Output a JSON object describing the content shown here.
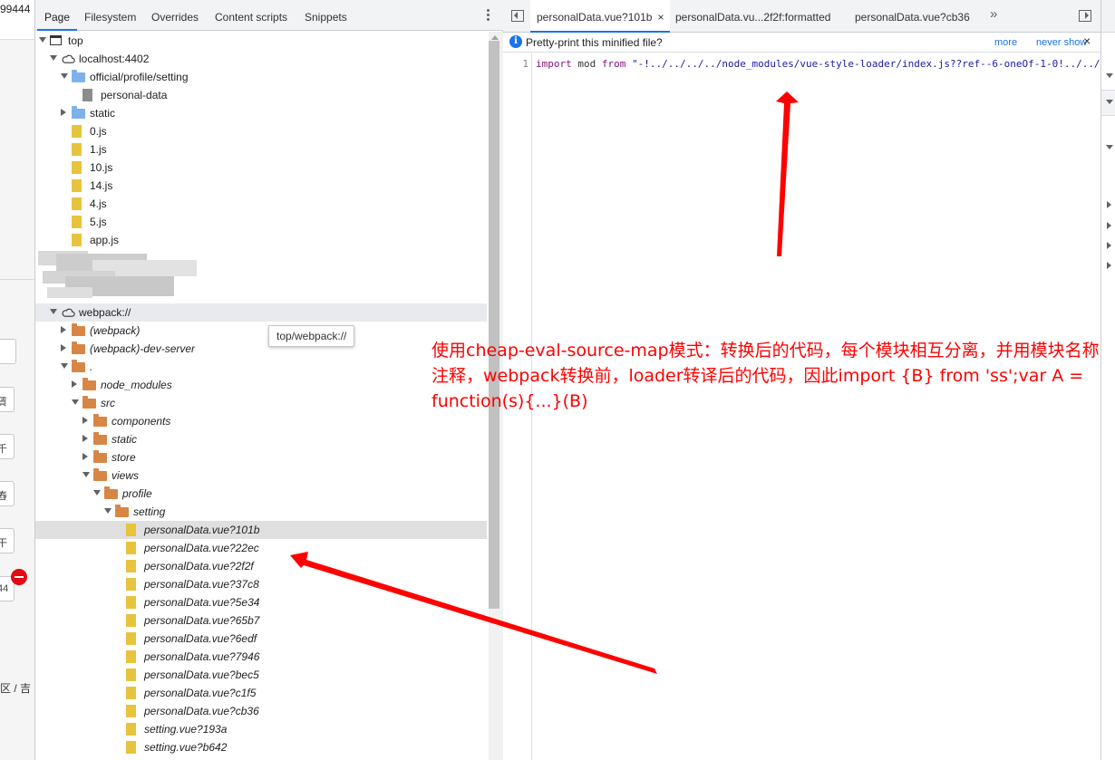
{
  "left_strip": {
    "number": "99444",
    "box_glyphs": [
      "賃",
      "千",
      "舂",
      "干"
    ],
    "stepper_value": "44",
    "district": "区 / 吉"
  },
  "navigator": {
    "tabs": [
      {
        "label": "Page",
        "active": true
      },
      {
        "label": "Filesystem",
        "active": false
      },
      {
        "label": "Overrides",
        "active": false
      },
      {
        "label": "Content scripts",
        "active": false
      },
      {
        "label": "Snippets",
        "active": false
      }
    ],
    "tree": [
      {
        "label": "top",
        "icon": "frame-icon",
        "toggle": "down",
        "level": 0,
        "italic": false
      },
      {
        "label": "localhost:4402",
        "icon": "cloud-icon",
        "toggle": "down",
        "level": 1,
        "italic": false
      },
      {
        "label": "official/profile/setting",
        "icon": "folder-icon",
        "color": "blue",
        "toggle": "down",
        "level": 2,
        "italic": false
      },
      {
        "label": "personal-data",
        "icon": "file-icon",
        "color": "grey",
        "toggle": "none",
        "level": 3,
        "italic": false
      },
      {
        "label": "static",
        "icon": "folder-icon",
        "color": "blue",
        "toggle": "right",
        "level": 2,
        "italic": false
      },
      {
        "label": "0.js",
        "icon": "file-icon",
        "color": "yellow",
        "toggle": "none",
        "level": 2,
        "italic": false
      },
      {
        "label": "1.js",
        "icon": "file-icon",
        "color": "yellow",
        "toggle": "none",
        "level": 2,
        "italic": false
      },
      {
        "label": "10.js",
        "icon": "file-icon",
        "color": "yellow",
        "toggle": "none",
        "level": 2,
        "italic": false
      },
      {
        "label": "14.js",
        "icon": "file-icon",
        "color": "yellow",
        "toggle": "none",
        "level": 2,
        "italic": false
      },
      {
        "label": "4.js",
        "icon": "file-icon",
        "color": "yellow",
        "toggle": "none",
        "level": 2,
        "italic": false
      },
      {
        "label": "5.js",
        "icon": "file-icon",
        "color": "yellow",
        "toggle": "none",
        "level": 2,
        "italic": false
      },
      {
        "label": "app.js",
        "icon": "file-icon",
        "color": "yellow",
        "toggle": "none",
        "level": 2,
        "italic": false
      },
      {
        "label": "",
        "icon": "none",
        "toggle": "blurred",
        "level": 0,
        "italic": false
      },
      {
        "label": "",
        "icon": "none",
        "toggle": "blurred",
        "level": 0,
        "italic": false
      },
      {
        "label": "",
        "icon": "none",
        "toggle": "blurred",
        "level": 0,
        "italic": false
      },
      {
        "label": "webpack://",
        "icon": "cloud-icon",
        "toggle": "down",
        "level": 1,
        "italic": false,
        "highlight": true
      },
      {
        "label": "(webpack)",
        "icon": "folder-icon",
        "color": "orange",
        "toggle": "right",
        "level": 2,
        "italic": true
      },
      {
        "label": "(webpack)-dev-server",
        "icon": "folder-icon",
        "color": "orange",
        "toggle": "right",
        "level": 2,
        "italic": true
      },
      {
        "label": ".",
        "icon": "folder-icon",
        "color": "orange",
        "toggle": "down",
        "level": 2,
        "italic": true
      },
      {
        "label": "node_modules",
        "icon": "folder-icon",
        "color": "orange",
        "toggle": "right",
        "level": 3,
        "italic": true
      },
      {
        "label": "src",
        "icon": "folder-icon",
        "color": "orange",
        "toggle": "down",
        "level": 3,
        "italic": true
      },
      {
        "label": "components",
        "icon": "folder-icon",
        "color": "orange",
        "toggle": "right",
        "level": 4,
        "italic": true
      },
      {
        "label": "static",
        "icon": "folder-icon",
        "color": "orange",
        "toggle": "right",
        "level": 4,
        "italic": true
      },
      {
        "label": "store",
        "icon": "folder-icon",
        "color": "orange",
        "toggle": "right",
        "level": 4,
        "italic": true
      },
      {
        "label": "views",
        "icon": "folder-icon",
        "color": "orange",
        "toggle": "down",
        "level": 4,
        "italic": true
      },
      {
        "label": "profile",
        "icon": "folder-icon",
        "color": "orange",
        "toggle": "down",
        "level": 5,
        "italic": true
      },
      {
        "label": "setting",
        "icon": "folder-icon",
        "color": "orange",
        "toggle": "down",
        "level": 6,
        "italic": true
      },
      {
        "label": "personalData.vue?101b",
        "icon": "file-icon",
        "color": "yellow",
        "toggle": "none",
        "level": 7,
        "italic": true,
        "selected": true
      },
      {
        "label": "personalData.vue?22ec",
        "icon": "file-icon",
        "color": "yellow",
        "toggle": "none",
        "level": 7,
        "italic": true
      },
      {
        "label": "personalData.vue?2f2f",
        "icon": "file-icon",
        "color": "yellow",
        "toggle": "none",
        "level": 7,
        "italic": true
      },
      {
        "label": "personalData.vue?37c8",
        "icon": "file-icon",
        "color": "yellow",
        "toggle": "none",
        "level": 7,
        "italic": true
      },
      {
        "label": "personalData.vue?5e34",
        "icon": "file-icon",
        "color": "yellow",
        "toggle": "none",
        "level": 7,
        "italic": true
      },
      {
        "label": "personalData.vue?65b7",
        "icon": "file-icon",
        "color": "yellow",
        "toggle": "none",
        "level": 7,
        "italic": true
      },
      {
        "label": "personalData.vue?6edf",
        "icon": "file-icon",
        "color": "yellow",
        "toggle": "none",
        "level": 7,
        "italic": true
      },
      {
        "label": "personalData.vue?7946",
        "icon": "file-icon",
        "color": "yellow",
        "toggle": "none",
        "level": 7,
        "italic": true
      },
      {
        "label": "personalData.vue?bec5",
        "icon": "file-icon",
        "color": "yellow",
        "toggle": "none",
        "level": 7,
        "italic": true
      },
      {
        "label": "personalData.vue?c1f5",
        "icon": "file-icon",
        "color": "yellow",
        "toggle": "none",
        "level": 7,
        "italic": true
      },
      {
        "label": "personalData.vue?cb36",
        "icon": "file-icon",
        "color": "yellow",
        "toggle": "none",
        "level": 7,
        "italic": true
      },
      {
        "label": "setting.vue?193a",
        "icon": "file-icon",
        "color": "yellow",
        "toggle": "none",
        "level": 7,
        "italic": true
      },
      {
        "label": "setting.vue?b642",
        "icon": "file-icon",
        "color": "yellow",
        "toggle": "none",
        "level": 7,
        "italic": true
      }
    ],
    "tooltip": "top/webpack://"
  },
  "editor": {
    "tabs": [
      {
        "label": "personalData.vue?101b",
        "active": true,
        "closable": true
      },
      {
        "label": "personalData.vu...2f2f:formatted",
        "active": false,
        "closable": false
      },
      {
        "label": "personalData.vue?cb36",
        "active": false,
        "closable": false
      }
    ],
    "close_glyph": "×",
    "more_tabs_glyph": "»",
    "infobar": {
      "icon_glyph": "i",
      "text": "Pretty-print this minified file?",
      "more": "more",
      "never_show": "never show",
      "close_glyph": "×"
    },
    "line_number": "1",
    "code": {
      "kw_import": "import",
      "ident": "mod",
      "kw_from": "from",
      "string": "\"-!../../../../node_modules/vue-style-loader/index.js??ref--6-oneOf-1-0!../../"
    }
  },
  "annotation": {
    "text": "使用cheap-eval-source-map模式：转换后的代码，每个模块相互分离，并用模块名称注释，webpack转换前，loader转译后的代码，因此import {B} from 'ss';var A = function(s){...}(B)",
    "color": "#ff0000"
  },
  "colors": {
    "accent": "#1a73e8",
    "folder_blue": "#7fb2ea",
    "folder_orange": "#d88645",
    "file_yellow": "#e8c33d",
    "annotation_red": "#ff0000"
  }
}
